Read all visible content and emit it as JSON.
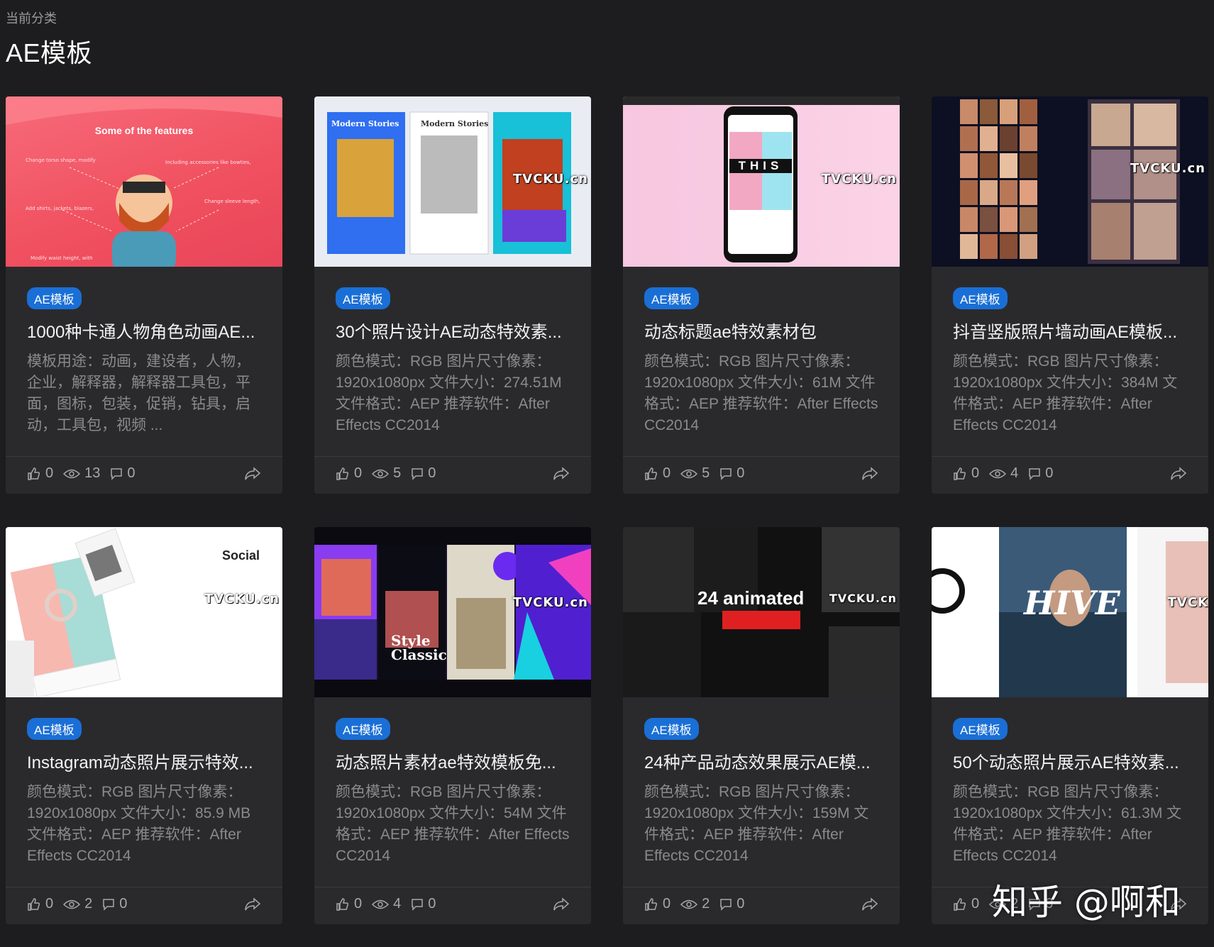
{
  "header": {
    "crumb": "当前分类",
    "title": "AE模板"
  },
  "cards": [
    {
      "watermark": "",
      "thumb_text": "Some of the features",
      "badge": "AE模板",
      "title": "1000种卡通人物角色动画AE...",
      "desc": "模板用途：动画，建设者，人物，企业，解释器，解释器工具包，平面，图标，包装，促销，钻具，启动，工具包，视频 ...",
      "likes": "0",
      "views": "13",
      "comments": "0"
    },
    {
      "watermark": "TVCKU.cn",
      "thumb_text": "Modern Stories",
      "badge": "AE模板",
      "title": "30个照片设计AE动态特效素...",
      "desc": "颜色模式：RGB 图片尺寸像素：1920x1080px 文件大小：274.51M 文件格式：AEP 推荐软件：After Effects CC2014",
      "likes": "0",
      "views": "5",
      "comments": "0"
    },
    {
      "watermark": "TVCKU.cn",
      "thumb_text": "THIS",
      "badge": "AE模板",
      "title": "动态标题ae特效素材包",
      "desc": "颜色模式：RGB 图片尺寸像素：1920x1080px 文件大小：61M 文件格式：AEP 推荐软件：After Effects CC2014",
      "likes": "0",
      "views": "5",
      "comments": "0"
    },
    {
      "watermark": "TVCKU.cn",
      "thumb_text": "",
      "badge": "AE模板",
      "title": "抖音竖版照片墙动画AE模板...",
      "desc": "颜色模式：RGB 图片尺寸像素：1920x1080px 文件大小：384M 文件格式：AEP 推荐软件：After Effects CC2014",
      "likes": "0",
      "views": "4",
      "comments": "0"
    },
    {
      "watermark": "TVCKU.cn",
      "thumb_text": "Social",
      "badge": "AE模板",
      "title": "Instagram动态照片展示特效...",
      "desc": "颜色模式：RGB 图片尺寸像素：1920x1080px 文件大小：85.9 MB 文件格式：AEP 推荐软件：After Effects CC2014",
      "likes": "0",
      "views": "2",
      "comments": "0"
    },
    {
      "watermark": "TVCKU.cn",
      "thumb_text": "Style Classic",
      "badge": "AE模板",
      "title": "动态照片素材ae特效模板免...",
      "desc": "颜色模式：RGB 图片尺寸像素：1920x1080px 文件大小：54M 文件格式：AEP 推荐软件：After Effects CC2014",
      "likes": "0",
      "views": "4",
      "comments": "0"
    },
    {
      "watermark": "TVCKU.cn",
      "thumb_text": "24 animated",
      "badge": "AE模板",
      "title": "24种产品动态效果展示AE模...",
      "desc": "颜色模式：RGB 图片尺寸像素：1920x1080px 文件大小：159M 文件格式：AEP 推荐软件：After Effects CC2014",
      "likes": "0",
      "views": "2",
      "comments": "0"
    },
    {
      "watermark": "TVCK",
      "thumb_text": "HIVE",
      "badge": "AE模板",
      "title": "50个动态照片展示AE特效素...",
      "desc": "颜色模式：RGB 图片尺寸像素：1920x1080px 文件大小：61.3M 文件格式：AEP 推荐软件：After Effects CC2014",
      "likes": "0",
      "views": "2",
      "comments": "0"
    }
  ],
  "overlay": {
    "zhihu": "知乎 @啊和"
  }
}
